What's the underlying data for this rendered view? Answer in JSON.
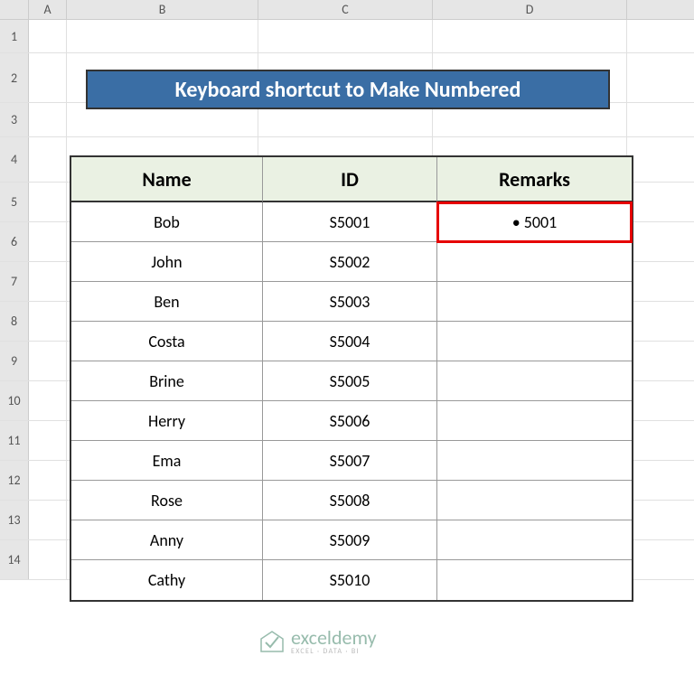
{
  "columns": [
    "A",
    "B",
    "C",
    "D"
  ],
  "rows": [
    "1",
    "2",
    "3",
    "4",
    "5",
    "6",
    "7",
    "8",
    "9",
    "10",
    "11",
    "12",
    "13",
    "14"
  ],
  "title": "Keyboard shortcut to Make Numbered",
  "headers": {
    "name": "Name",
    "id": "ID",
    "remarks": "Remarks"
  },
  "data": [
    {
      "name": "Bob",
      "id": "S5001",
      "remarks": "• 5001"
    },
    {
      "name": "John",
      "id": "S5002",
      "remarks": ""
    },
    {
      "name": "Ben",
      "id": "S5003",
      "remarks": ""
    },
    {
      "name": "Costa",
      "id": "S5004",
      "remarks": ""
    },
    {
      "name": "Brine",
      "id": "S5005",
      "remarks": ""
    },
    {
      "name": "Herry",
      "id": "S5006",
      "remarks": ""
    },
    {
      "name": "Ema",
      "id": "S5007",
      "remarks": ""
    },
    {
      "name": "Rose",
      "id": "S5008",
      "remarks": ""
    },
    {
      "name": "Anny",
      "id": "S5009",
      "remarks": ""
    },
    {
      "name": "Cathy",
      "id": "S5010",
      "remarks": ""
    }
  ],
  "watermark": {
    "main": "exceldemy",
    "sub": "EXCEL · DATA · BI"
  }
}
